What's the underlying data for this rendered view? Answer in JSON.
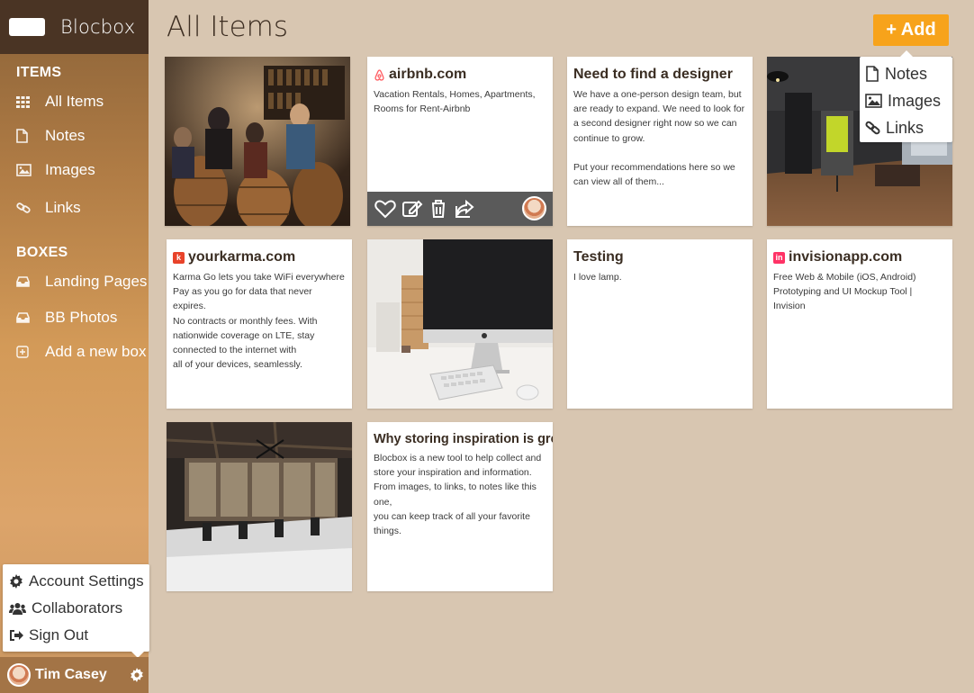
{
  "app": {
    "brand": "Blocbox",
    "page_title": "All Items",
    "add_label": "+ Add"
  },
  "sidebar": {
    "items_heading": "ITEMS",
    "items": [
      {
        "label": "All Items",
        "icon": "grid-icon"
      },
      {
        "label": "Notes",
        "icon": "document-icon"
      },
      {
        "label": "Images",
        "icon": "image-icon"
      },
      {
        "label": "Links",
        "icon": "link-icon"
      }
    ],
    "boxes_heading": "BOXES",
    "boxes": [
      {
        "label": "Landing Pages",
        "icon": "inbox-icon"
      },
      {
        "label": "BB Photos",
        "icon": "inbox-icon"
      },
      {
        "label": "Add a new box",
        "icon": "plus-square-icon"
      }
    ]
  },
  "account_menu": [
    {
      "label": "Account Settings",
      "icon": "gear-icon"
    },
    {
      "label": "Collaborators",
      "icon": "users-icon"
    },
    {
      "label": "Sign Out",
      "icon": "sign-out-icon"
    }
  ],
  "user": {
    "name": "Tim Casey"
  },
  "add_menu": [
    {
      "label": "Notes",
      "icon": "document-icon"
    },
    {
      "label": "Images",
      "icon": "image-icon"
    },
    {
      "label": "Links",
      "icon": "link-icon"
    }
  ],
  "cards": {
    "airbnb": {
      "title": "airbnb.com",
      "body": "Vacation Rentals, Homes, Apartments,\nRooms for Rent-Airbnb"
    },
    "designer": {
      "title": "Need to find a designer",
      "body": "We have a one-person design team, but\nare ready to expand. We need to look for\na second designer right now so we can\ncontinue to grow.\n\nPut your recommendations here so we\ncan view all of them..."
    },
    "yourkarma": {
      "title": "yourkarma.com",
      "body": "Karma Go lets you take WiFi everywhere\nPay as you go for data that never expires.\nNo contracts or monthly fees. With\nnationwide coverage on LTE, stay\nconnected to the internet with\nall of your devices, seamlessly."
    },
    "testing": {
      "title": "Testing",
      "body": "I love lamp."
    },
    "invision": {
      "title": "invisionapp.com",
      "body": "Free Web & Mobile (iOS, Android)\nPrototyping and UI Mockup Tool | Invision"
    },
    "inspiration": {
      "title": "Why storing inspiration is great",
      "body": "Blocbox is a new tool to help collect and\nstore your inspiration and information.\nFrom images, to links, to notes like this one,\nyou can keep track of all your favorite\nthings."
    }
  },
  "colors": {
    "accent": "#f7a31b",
    "background": "#d8c6b1",
    "sidebar_dark": "#4a3424",
    "airbnb": "#ff5a5f",
    "yourkarma": "#e8432a",
    "invision": "#ff3366"
  }
}
